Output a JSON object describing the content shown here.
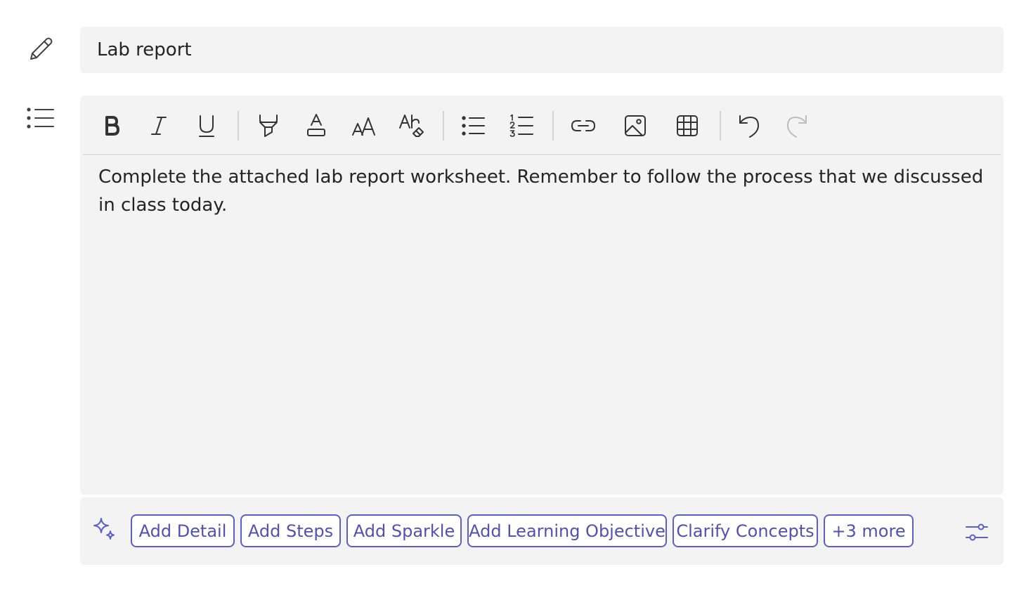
{
  "title_field": {
    "value": "Lab report"
  },
  "toolbar": {
    "buttons": [
      {
        "name": "bold",
        "icon": "bold-icon",
        "enabled": true
      },
      {
        "name": "italic",
        "icon": "italic-icon",
        "enabled": true
      },
      {
        "name": "underline",
        "icon": "underline-icon",
        "enabled": true
      },
      {
        "name": "highlight",
        "icon": "highlighter-icon",
        "enabled": true
      },
      {
        "name": "font-color",
        "icon": "font-color-icon",
        "enabled": true
      },
      {
        "name": "font-size",
        "icon": "font-size-icon",
        "enabled": true
      },
      {
        "name": "clear-formatting",
        "icon": "clear-formatting-icon",
        "enabled": true
      },
      {
        "name": "bulleted-list",
        "icon": "bulleted-list-icon",
        "enabled": true
      },
      {
        "name": "numbered-list",
        "icon": "numbered-list-icon",
        "enabled": true
      },
      {
        "name": "link",
        "icon": "link-icon",
        "enabled": true
      },
      {
        "name": "image",
        "icon": "image-icon",
        "enabled": true
      },
      {
        "name": "table",
        "icon": "table-icon",
        "enabled": true
      },
      {
        "name": "undo",
        "icon": "undo-icon",
        "enabled": true
      },
      {
        "name": "redo",
        "icon": "redo-icon",
        "enabled": false
      }
    ]
  },
  "editor": {
    "body": "Complete the attached lab report worksheet. Remember to follow the process that we discussed in class today."
  },
  "suggestions": {
    "chips": [
      {
        "label": "Add Detail"
      },
      {
        "label": "Add Steps"
      },
      {
        "label": "Add Sparkle"
      },
      {
        "label": "Add Learning Objective"
      },
      {
        "label": "Clarify Concepts"
      },
      {
        "label": "+3 more"
      }
    ]
  },
  "colors": {
    "accent": "#5b5fc7",
    "field_background": "#f3f3f3",
    "text": "#242424"
  }
}
